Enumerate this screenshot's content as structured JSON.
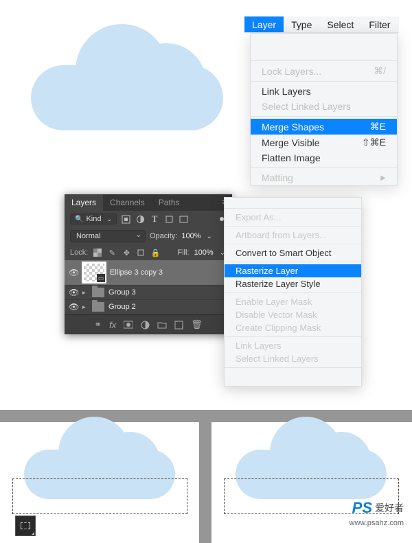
{
  "menubar": {
    "active": "Layer",
    "items": [
      "Type",
      "Select",
      "Filter"
    ]
  },
  "layer_menu": {
    "lock": "Lock Layers...",
    "lock_shortcut": "⌘/",
    "link": "Link Layers",
    "select_linked": "Select Linked Layers",
    "merge_shapes": "Merge Shapes",
    "merge_shapes_shortcut": "⌘E",
    "merge_visible": "Merge Visible",
    "merge_visible_shortcut": "⇧⌘E",
    "flatten": "Flatten Image",
    "matting": "Matting"
  },
  "layers_panel": {
    "tabs": {
      "layers": "Layers",
      "channels": "Channels",
      "paths": "Paths"
    },
    "kind": "Kind",
    "blend": "Normal",
    "opacity_label": "Opacity:",
    "opacity_value": "100%",
    "lock_label": "Lock:",
    "fill_label": "Fill:",
    "fill_value": "100%",
    "items": [
      {
        "name": "Ellipse 3 copy 3"
      },
      {
        "name": "Group 3"
      },
      {
        "name": "Group 2"
      }
    ]
  },
  "context_menu": {
    "faded": [
      "",
      "",
      "Export As..."
    ],
    "before_divider": "Artboard from Layers...",
    "convert": "Convert to Smart Object",
    "rasterize": "Rasterize Layer",
    "rasterize_style": "Rasterize Layer Style",
    "enable_mask": "Enable Layer Mask",
    "disable_vector": "Disable Vector Mask",
    "clipping": "Create Clipping Mask",
    "link": "Link Layers",
    "select_linked": "Select Linked Layers"
  },
  "watermark": {
    "brand": "PS",
    "cn": "爱好者",
    "url": "www.psahz.com"
  }
}
